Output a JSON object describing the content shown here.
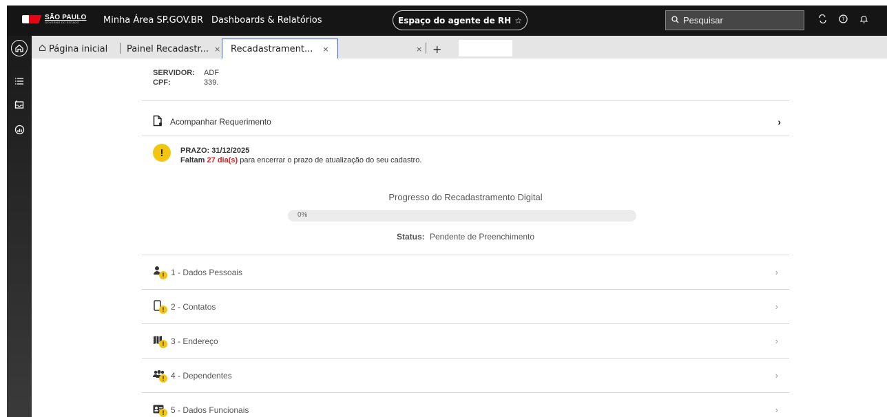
{
  "topbar": {
    "logo_line1": "SÃO PAULO",
    "logo_line2": "GOVERNO DO ESTADO",
    "nav": [
      "Minha Área SP.GOV.BR",
      "Dashboards & Relatórios"
    ],
    "agent_label": "Espaço do agente de RH",
    "agent_star": "☆",
    "search_placeholder": "Pesquisar",
    "icons": [
      "sync-icon",
      "help-icon",
      "bell-icon"
    ]
  },
  "tabs": {
    "home": "Página inicial",
    "tab1": "Painel Recadastr...",
    "tab2": "Recadastrament...",
    "close": "×",
    "add": "+"
  },
  "servidor": {
    "servidor_label": "SERVIDOR:",
    "servidor_value": "ADF",
    "cpf_label": "CPF:",
    "cpf_value": "339."
  },
  "acompanhar": "Acompanhar Requerimento",
  "prazo": {
    "title": "PRAZO: 31/12/2025",
    "prefix": "Faltam",
    "days": "27 dia(s)",
    "suffix": "para encerrar o prazo de atualização do seu cadastro."
  },
  "progress": {
    "title": "Progresso do Recadastramento Digital",
    "label": "0%",
    "value": 0,
    "status_key": "Status:",
    "status_value": "Pendente de Preenchimento"
  },
  "sections": [
    {
      "label": "1 - Dados Pessoais",
      "icon": "person-icon"
    },
    {
      "label": "2 - Contatos",
      "icon": "phone-icon"
    },
    {
      "label": "3 - Endereço",
      "icon": "map-icon"
    },
    {
      "label": "4 - Dependentes",
      "icon": "people-icon"
    },
    {
      "label": "5 - Dados Funcionais",
      "icon": "id-card-icon"
    }
  ],
  "colors": {
    "accent": "#3a5fd0",
    "warning": "#f2c511",
    "danger": "#e02020"
  }
}
